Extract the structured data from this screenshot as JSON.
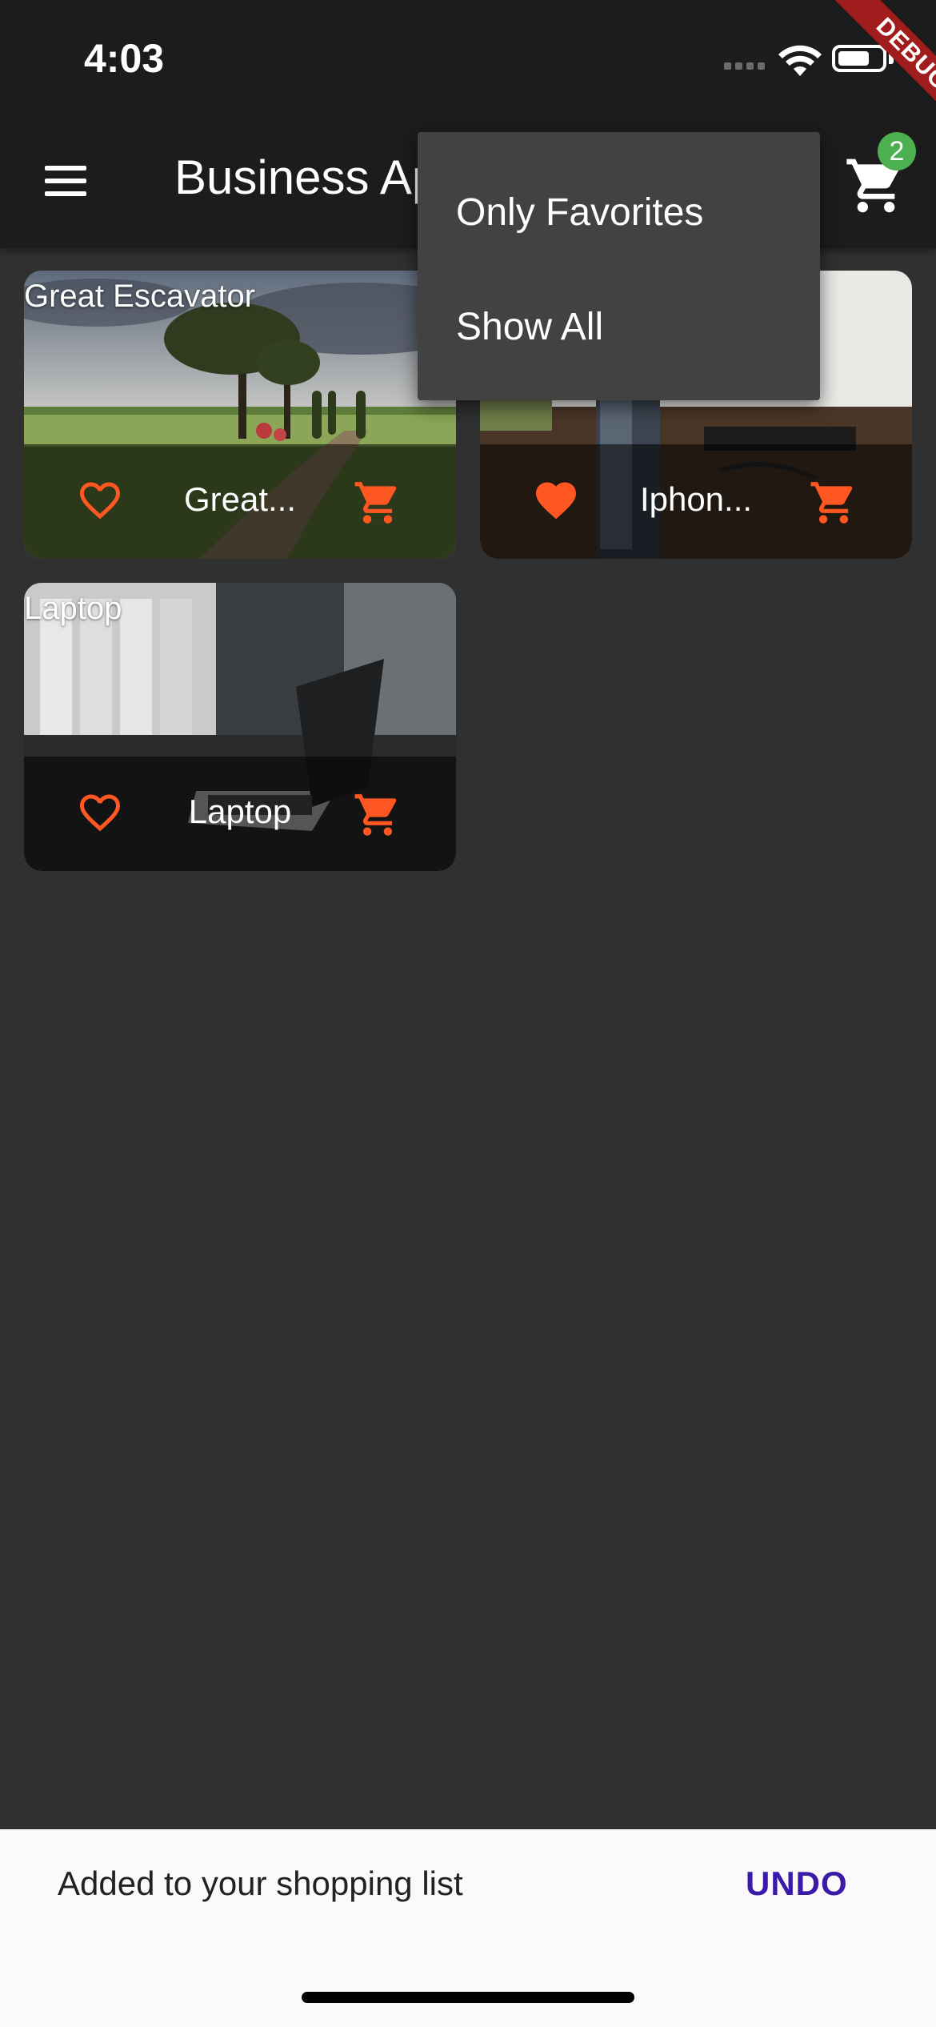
{
  "status_bar": {
    "time": "4:03"
  },
  "app_bar": {
    "title": "Business App",
    "cart_count": "2"
  },
  "debug_banner": "DEBUG",
  "products": [
    {
      "overlay_label": "Great Escavator",
      "title": "Great...",
      "favorite": false
    },
    {
      "overlay_label": "",
      "title": "Iphon...",
      "favorite": true
    },
    {
      "overlay_label": "Laptop",
      "title": "Laptop",
      "favorite": false
    }
  ],
  "popup_menu": {
    "items": [
      "Only Favorites",
      "Show All"
    ]
  },
  "snackbar": {
    "message": "Added to your shopping list",
    "action": "UNDO"
  },
  "colors": {
    "accent": "#ff5722",
    "background": "#303030",
    "app_bar": "#1c1c1c",
    "badge": "#4caf50",
    "snackbar_action": "#3a1aa8"
  }
}
